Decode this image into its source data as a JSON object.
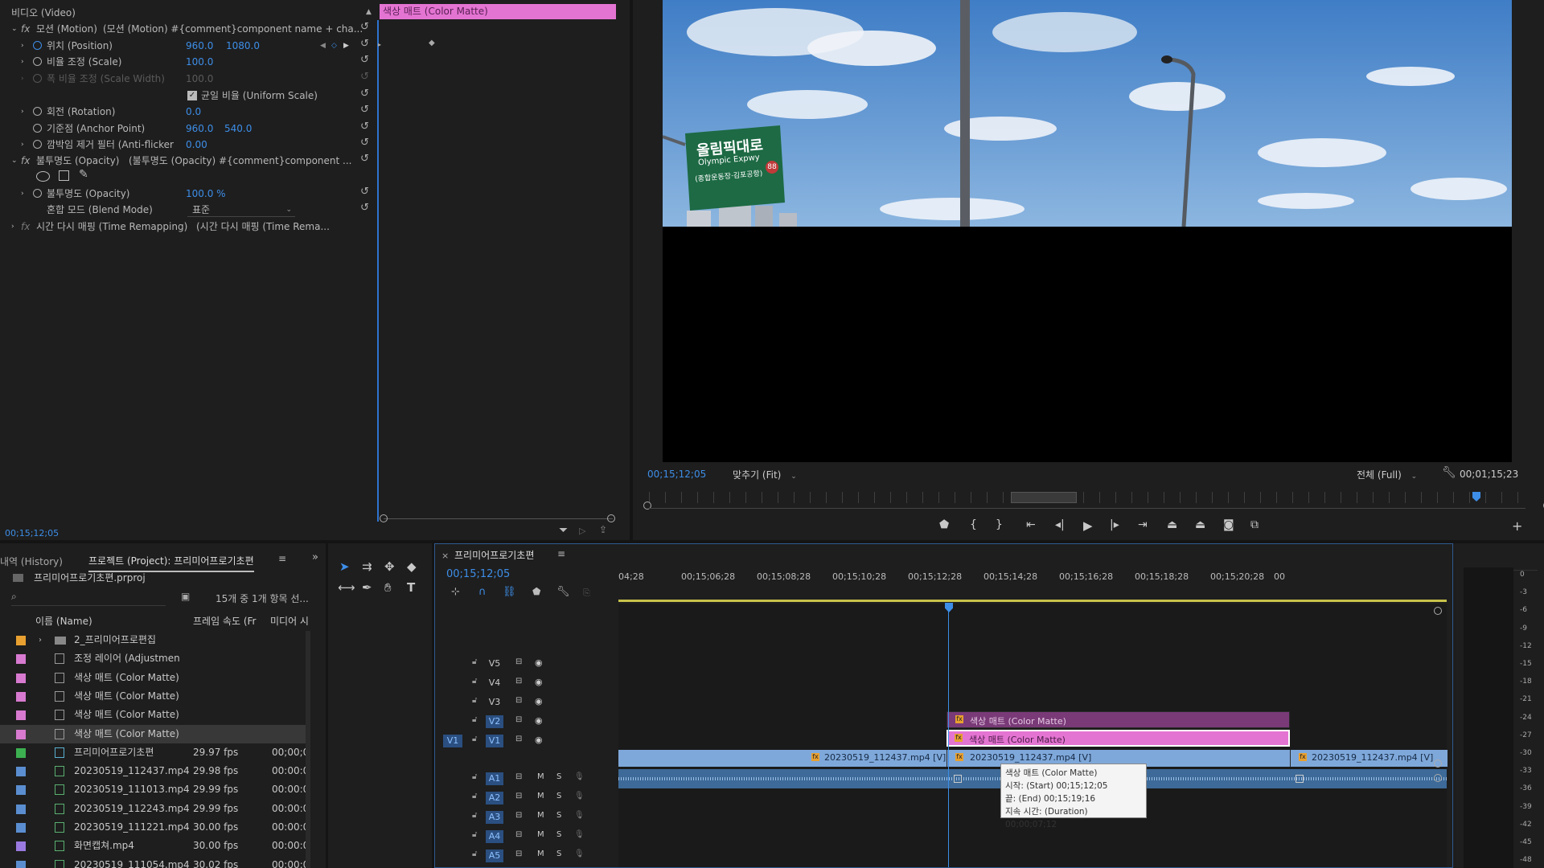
{
  "effect_controls": {
    "section_video": "비디오 (Video)",
    "clip_header": "색상 매트 (Color Matte)",
    "motion": {
      "label": "모션 (Motion)",
      "desc": "(모션 (Motion) #{comment}component name + cha..."
    },
    "position": {
      "label": "위치 (Position)",
      "x": "960.0",
      "y": "1080.0"
    },
    "scale": {
      "label": "비율 조정 (Scale)",
      "value": "100.0"
    },
    "scale_width": {
      "label": "폭 비율 조정 (Scale Width)",
      "value": "100.0"
    },
    "uniform_scale": {
      "label": "균일 비율 (Uniform Scale)",
      "checked": true
    },
    "rotation": {
      "label": "회전 (Rotation)",
      "value": "0.0"
    },
    "anchor": {
      "label": "기준점 (Anchor Point)",
      "x": "960.0",
      "y": "540.0"
    },
    "antiflicker": {
      "label": "깜박임 제거 필터 (Anti-flicker",
      "value": "0.00"
    },
    "opacity_fx": {
      "label": "불투명도 (Opacity)",
      "desc": "(불투명도 (Opacity) #{comment}component ..."
    },
    "opacity": {
      "label": "불투명도 (Opacity)",
      "value": "100.0 %"
    },
    "blend": {
      "label": "혼합 모드 (Blend Mode)",
      "value": "표준"
    },
    "time_remap": {
      "label": "시간 다시 매핑 (Time Remapping)",
      "desc": "(시간 다시 매핑 (Time Rema..."
    },
    "timecode": "00;15;12;05"
  },
  "program_monitor": {
    "sign_main": "올림픽대로",
    "sign_sub": "Olympic Expwy",
    "sign_sub2": "(종합운동장·김포공항)",
    "sign_num": "88",
    "timecode": "00;15;12;05",
    "fit_label": "맞추기 (Fit)",
    "quality_label": "전체 (Full)",
    "duration": "00;01;15;23"
  },
  "project_panel": {
    "tab_history": "내역 (History)",
    "tab_project": "프로젝트 (Project): 프리미어프로기초편",
    "file": "프리미어프로기초편.prproj",
    "selection_info": "15개 중 1개 항목 선...",
    "col_name": "이름 (Name)",
    "col_fps": "프레임 속도 (Fr",
    "col_media": "미디어 시",
    "items": [
      {
        "color": "#e8a030",
        "type": "folder",
        "name": "2_프리미어프로편집",
        "fps": "",
        "start": ""
      },
      {
        "color": "#d87ad0",
        "type": "file",
        "name": "조정 레이어 (Adjustmen",
        "fps": "",
        "start": ""
      },
      {
        "color": "#d87ad0",
        "type": "file",
        "name": "색상 매트 (Color Matte)",
        "fps": "",
        "start": ""
      },
      {
        "color": "#d87ad0",
        "type": "file",
        "name": "색상 매트 (Color Matte)",
        "fps": "",
        "start": ""
      },
      {
        "color": "#d87ad0",
        "type": "file",
        "name": "색상 매트 (Color Matte)",
        "fps": "",
        "start": ""
      },
      {
        "color": "#d87ad0",
        "type": "file",
        "name": "색상 매트 (Color Matte)",
        "fps": "",
        "start": ""
      },
      {
        "color": "#3cb050",
        "type": "seq",
        "name": "프리미어프로기초편",
        "fps": "29.97 fps",
        "start": "00;00;0"
      },
      {
        "color": "#5a8ed0",
        "type": "video",
        "name": "20230519_112437.mp4",
        "fps": "29.98 fps",
        "start": "00:00:0"
      },
      {
        "color": "#5a8ed0",
        "type": "video",
        "name": "20230519_111013.mp4",
        "fps": "29.99 fps",
        "start": "00:00:0"
      },
      {
        "color": "#5a8ed0",
        "type": "video",
        "name": "20230519_112243.mp4",
        "fps": "29.99 fps",
        "start": "00:00:0"
      },
      {
        "color": "#5a8ed0",
        "type": "video",
        "name": "20230519_111221.mp4",
        "fps": "30.00 fps",
        "start": "00:00:0"
      },
      {
        "color": "#9a7ae0",
        "type": "video",
        "name": "화면캡쳐.mp4",
        "fps": "30.00 fps",
        "start": "00:00:0"
      },
      {
        "color": "#5a8ed0",
        "type": "video",
        "name": "20230519_111054.mp4",
        "fps": "30.02 fps",
        "start": "00:00:0"
      }
    ]
  },
  "timeline": {
    "tab": "프리미어프로기초편",
    "timecode": "00;15;12;05",
    "ruler": [
      "04;28",
      "00;15;06;28",
      "00;15;08;28",
      "00;15;10;28",
      "00;15;12;28",
      "00;15;14;28",
      "00;15;16;28",
      "00;15;18;28",
      "00;15;20;28",
      "00"
    ],
    "video_tracks": [
      "V5",
      "V4",
      "V3",
      "V2",
      "V1"
    ],
    "audio_tracks": [
      "A1",
      "A2",
      "A3",
      "A4",
      "A5"
    ],
    "v1_source": "V1",
    "mute": "M",
    "solo": "S",
    "clips": {
      "v3": "색상 매트 (Color Matte)",
      "v2": "색상 매트 (Color Matte)",
      "v1a": "20230519_112437.mp4 [V]",
      "v1b": "20230519_112437.mp4 [V]",
      "v1c": "20230519_112437.mp4 [V]"
    },
    "tooltip": {
      "line1": "색상 매트 (Color Matte)",
      "line2": "시작: (Start) 00;15;12;05",
      "line3": "끝: (End) 00;15;19;16",
      "line4": "지속 시간: (Duration) 00;00;07;12"
    }
  },
  "audio_meter": {
    "scale": [
      "0",
      "-3",
      "-6",
      "-9",
      "-12",
      "-15",
      "-18",
      "-21",
      "-24",
      "-27",
      "-30",
      "-33",
      "-36",
      "-39",
      "-42",
      "-45",
      "-48"
    ]
  }
}
